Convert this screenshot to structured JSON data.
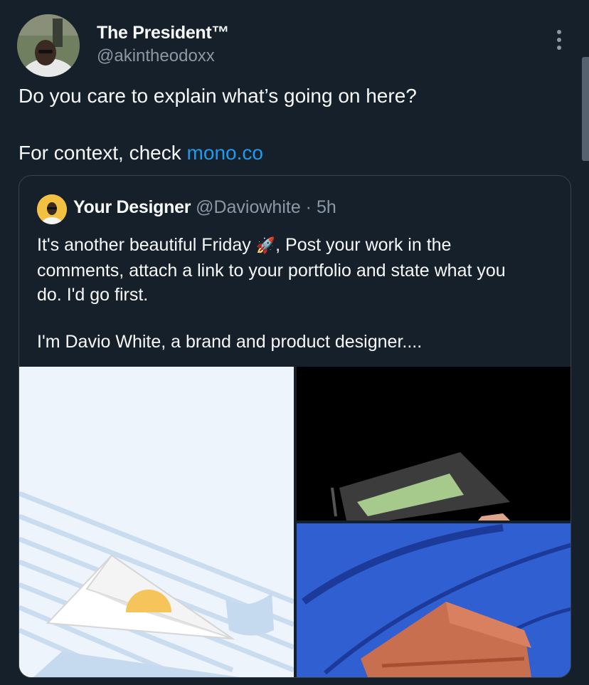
{
  "author": {
    "name": "The President™",
    "handle": "@akintheodoxx"
  },
  "tweet": {
    "line1": "Do you care to explain what’s going on here?",
    "line2_prefix": "For context, check ",
    "link": "mono.co"
  },
  "quoted_tweet": {
    "name": "Your Designer",
    "handle": "@Daviowhite",
    "separator": " · ",
    "time": "5h",
    "text_1a": "It's another beautiful Friday ",
    "emoji": "🚀",
    "text_1b": ", Post your work in the",
    "text_2": "comments, attach a link to your portfolio and state what you",
    "text_3": "do. I'd go first.",
    "text_4": "I'm Davio White, a brand and product designer...."
  },
  "icons": {
    "more": "more-vertical-icon"
  },
  "colors": {
    "background": "#15202b",
    "link": "#1d9bf0",
    "secondary_text": "#8b98a5",
    "border": "#38444d"
  }
}
